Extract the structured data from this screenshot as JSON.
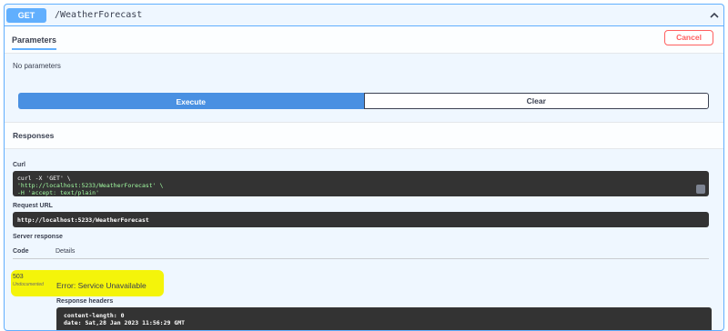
{
  "operation": {
    "method": "GET",
    "path": "/WeatherForecast"
  },
  "tabs": {
    "parameters": "Parameters",
    "cancel": "Cancel"
  },
  "params": {
    "none": "No parameters"
  },
  "actions": {
    "execute": "Execute",
    "clear": "Clear"
  },
  "responses": {
    "title": "Responses",
    "curl_label": "Curl",
    "curl_lines": [
      "curl -X 'GET' \\",
      "  'http://localhost:5233/WeatherForecast' \\",
      "  -H 'accept: text/plain'"
    ],
    "request_url_label": "Request URL",
    "request_url": "http://localhost:5233/WeatherForecast",
    "server_response_label": "Server response",
    "col_code": "Code",
    "col_details": "Details",
    "status_code": "503",
    "undocumented": "Undocumented",
    "error_text": "Error: Service Unavailable",
    "response_headers_label": "Response headers",
    "headers": [
      "content-length: 0",
      "date: Sat,28 Jan 2023 11:56:29 GMT"
    ]
  },
  "colors": {
    "get_blue": "#61affe",
    "execute_blue": "#4990e2",
    "cancel_red": "#ff6060",
    "highlight": "#f4f40a"
  }
}
